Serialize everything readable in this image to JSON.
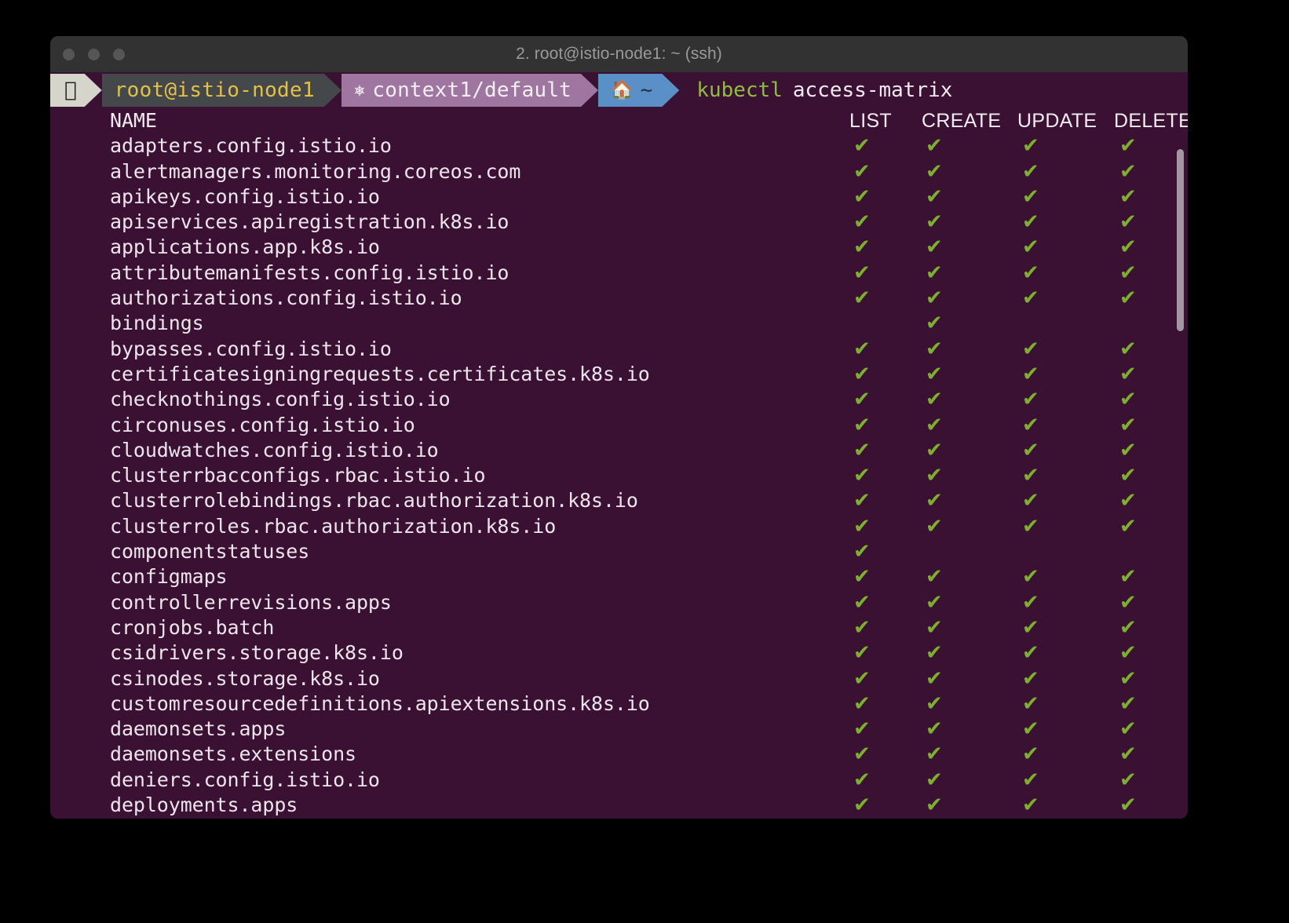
{
  "window": {
    "title": "2. root@istio-node1: ~ (ssh)",
    "traffic_lights": [
      "close",
      "minimize",
      "zoom"
    ],
    "background_color": "#3b1133",
    "titlebar_color": "#323232"
  },
  "prompt": {
    "apple_icon": "",
    "host_segment": "root@istio-node1",
    "host_color": "#e3c04a",
    "context_icon": "⎈",
    "context_segment": "context1/default",
    "context_color": "#9f76a0",
    "dir_icon": "⌂",
    "dir_segment": "~",
    "dir_color": "#5b8fc7",
    "command_binary": "kubectl",
    "command_args": "access-matrix",
    "command_color": "#8fbe3f"
  },
  "table": {
    "name_header": "NAME",
    "columns": [
      "LIST",
      "CREATE",
      "UPDATE",
      "DELETE"
    ],
    "check_glyph": "✔",
    "check_color": "#7cb02e",
    "rows": [
      {
        "name": "adapters.config.istio.io",
        "perms": [
          true,
          true,
          true,
          true
        ]
      },
      {
        "name": "alertmanagers.monitoring.coreos.com",
        "perms": [
          true,
          true,
          true,
          true
        ]
      },
      {
        "name": "apikeys.config.istio.io",
        "perms": [
          true,
          true,
          true,
          true
        ]
      },
      {
        "name": "apiservices.apiregistration.k8s.io",
        "perms": [
          true,
          true,
          true,
          true
        ]
      },
      {
        "name": "applications.app.k8s.io",
        "perms": [
          true,
          true,
          true,
          true
        ]
      },
      {
        "name": "attributemanifests.config.istio.io",
        "perms": [
          true,
          true,
          true,
          true
        ]
      },
      {
        "name": "authorizations.config.istio.io",
        "perms": [
          true,
          true,
          true,
          true
        ]
      },
      {
        "name": "bindings",
        "perms": [
          false,
          true,
          false,
          false
        ]
      },
      {
        "name": "bypasses.config.istio.io",
        "perms": [
          true,
          true,
          true,
          true
        ]
      },
      {
        "name": "certificatesigningrequests.certificates.k8s.io",
        "perms": [
          true,
          true,
          true,
          true
        ]
      },
      {
        "name": "checknothings.config.istio.io",
        "perms": [
          true,
          true,
          true,
          true
        ]
      },
      {
        "name": "circonuses.config.istio.io",
        "perms": [
          true,
          true,
          true,
          true
        ]
      },
      {
        "name": "cloudwatches.config.istio.io",
        "perms": [
          true,
          true,
          true,
          true
        ]
      },
      {
        "name": "clusterrbacconfigs.rbac.istio.io",
        "perms": [
          true,
          true,
          true,
          true
        ]
      },
      {
        "name": "clusterrolebindings.rbac.authorization.k8s.io",
        "perms": [
          true,
          true,
          true,
          true
        ]
      },
      {
        "name": "clusterroles.rbac.authorization.k8s.io",
        "perms": [
          true,
          true,
          true,
          true
        ]
      },
      {
        "name": "componentstatuses",
        "perms": [
          true,
          false,
          false,
          false
        ]
      },
      {
        "name": "configmaps",
        "perms": [
          true,
          true,
          true,
          true
        ]
      },
      {
        "name": "controllerrevisions.apps",
        "perms": [
          true,
          true,
          true,
          true
        ]
      },
      {
        "name": "cronjobs.batch",
        "perms": [
          true,
          true,
          true,
          true
        ]
      },
      {
        "name": "csidrivers.storage.k8s.io",
        "perms": [
          true,
          true,
          true,
          true
        ]
      },
      {
        "name": "csinodes.storage.k8s.io",
        "perms": [
          true,
          true,
          true,
          true
        ]
      },
      {
        "name": "customresourcedefinitions.apiextensions.k8s.io",
        "perms": [
          true,
          true,
          true,
          true
        ]
      },
      {
        "name": "daemonsets.apps",
        "perms": [
          true,
          true,
          true,
          true
        ]
      },
      {
        "name": "daemonsets.extensions",
        "perms": [
          true,
          true,
          true,
          true
        ]
      },
      {
        "name": "deniers.config.istio.io",
        "perms": [
          true,
          true,
          true,
          true
        ]
      },
      {
        "name": "deployments.apps",
        "perms": [
          true,
          true,
          true,
          true
        ]
      }
    ]
  },
  "scrollbar": {
    "visible": true,
    "thumb_color": "#b9aeb8"
  }
}
